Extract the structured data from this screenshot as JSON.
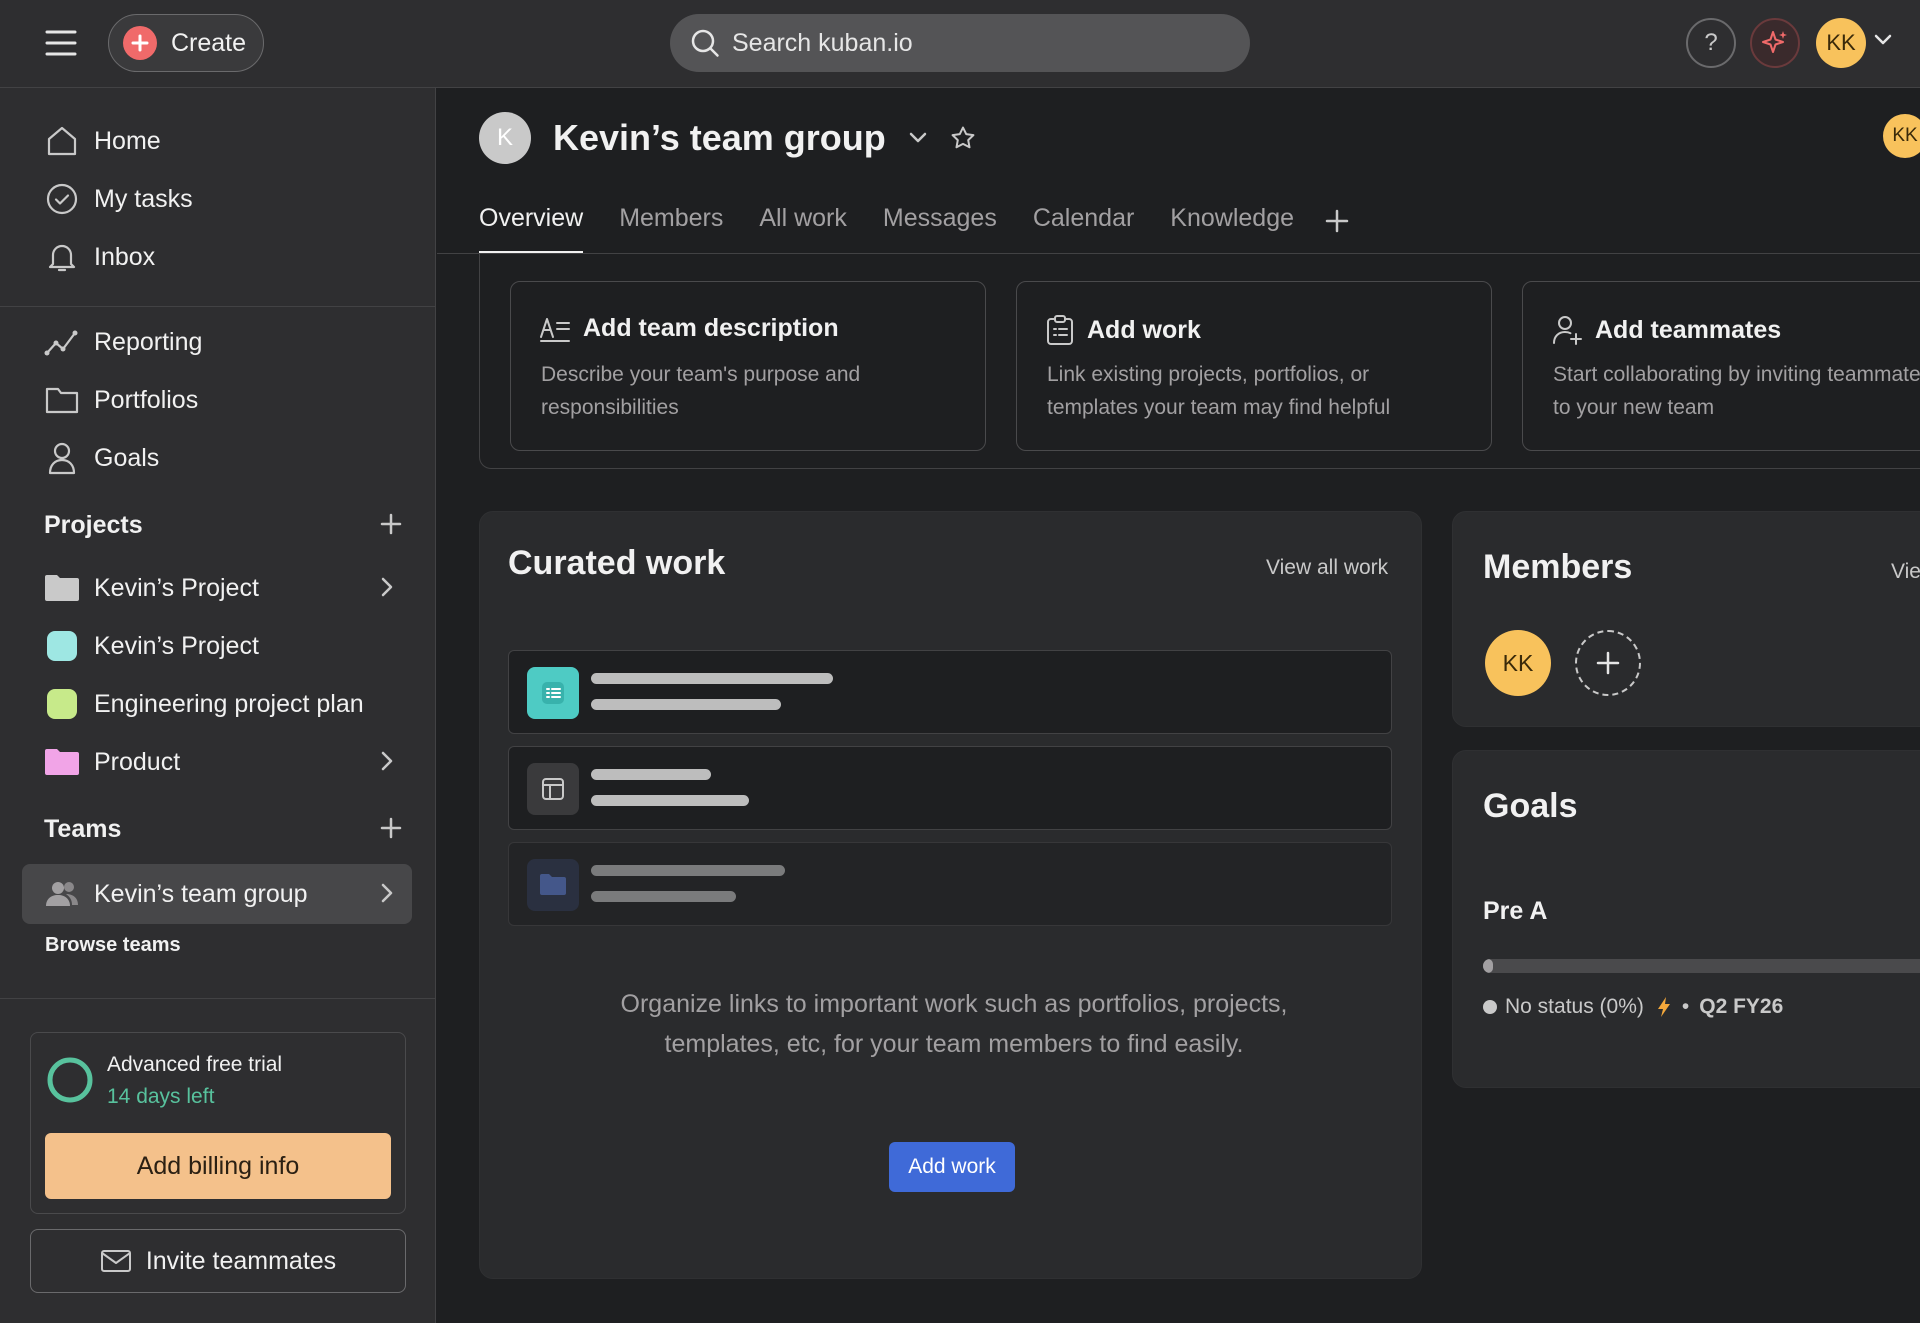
{
  "topbar": {
    "create_label": "Create",
    "search_placeholder": "Search kuban.io",
    "help_label": "?",
    "user_initials": "KK"
  },
  "sidebar": {
    "primary": [
      {
        "label": "Home",
        "icon": "home-icon"
      },
      {
        "label": "My tasks",
        "icon": "check-circle-icon"
      },
      {
        "label": "Inbox",
        "icon": "bell-icon"
      }
    ],
    "secondary": [
      {
        "label": "Reporting",
        "icon": "chart-line-icon"
      },
      {
        "label": "Portfolios",
        "icon": "folder-icon"
      },
      {
        "label": "Goals",
        "icon": "person-icon"
      }
    ],
    "projects_heading": "Projects",
    "projects": [
      {
        "label": "Kevin’s Project",
        "color": "#c9c9c9",
        "kind": "folder",
        "has_children": true
      },
      {
        "label": "Kevin’s Project",
        "color": "#9ee7e3",
        "kind": "square",
        "has_children": false
      },
      {
        "label": "Engineering project plan",
        "color": "#c7ea8a",
        "kind": "square",
        "has_children": false
      },
      {
        "label": "Product",
        "color": "#f1a4e7",
        "kind": "folder",
        "has_children": true
      }
    ],
    "teams_heading": "Teams",
    "teams": [
      {
        "label": "Kevin’s team group",
        "active": true
      }
    ],
    "browse_label": "Browse teams",
    "trial": {
      "title": "Advanced free trial",
      "days": "14 days left",
      "billing_label": "Add billing info"
    },
    "invite_label": "Invite teammates"
  },
  "team": {
    "avatar_letter": "K",
    "name": "Kevin’s team group",
    "right_initials": "KK",
    "tabs": [
      "Overview",
      "Members",
      "All work",
      "Messages",
      "Calendar",
      "Knowledge"
    ],
    "active_tab": 0
  },
  "setup_cards": [
    {
      "title": "Add team description",
      "icon": "text-description-icon",
      "desc": [
        "Describe your team's purpose and",
        "responsibilities"
      ]
    },
    {
      "title": "Add work",
      "icon": "clipboard-icon",
      "desc": [
        "Link existing projects, portfolios, or",
        "templates your team may find helpful"
      ]
    },
    {
      "title": "Add teammates",
      "icon": "add-person-icon",
      "desc": [
        "Start collaborating by inviting teammates",
        "to your new team"
      ]
    }
  ],
  "curated": {
    "title": "Curated work",
    "view_all": "View all work",
    "rows": [
      {
        "icon": "list-icon",
        "icon_bg": "#4ecbc4"
      },
      {
        "icon": "board-icon",
        "icon_bg": "#3a3a3c"
      },
      {
        "icon": "folder-icon",
        "icon_bg": "#2a3550"
      }
    ],
    "message": "Organize links to important work such as portfolios, projects, templates, etc, for your team members to find easily.",
    "add_label": "Add work"
  },
  "members": {
    "title": "Members",
    "view_all": "Vie",
    "initials": "KK"
  },
  "goals": {
    "title": "Goals",
    "items": [
      {
        "name": "Pre A",
        "progress": 0,
        "status": "No status (0%)",
        "period": "Q2 FY26"
      }
    ]
  },
  "colors": {
    "accent": "#3f6ad8",
    "create": "#f06a6a",
    "avatar": "#f8c25c",
    "trial_green": "#58c29d",
    "billing": "#f4c18b"
  }
}
